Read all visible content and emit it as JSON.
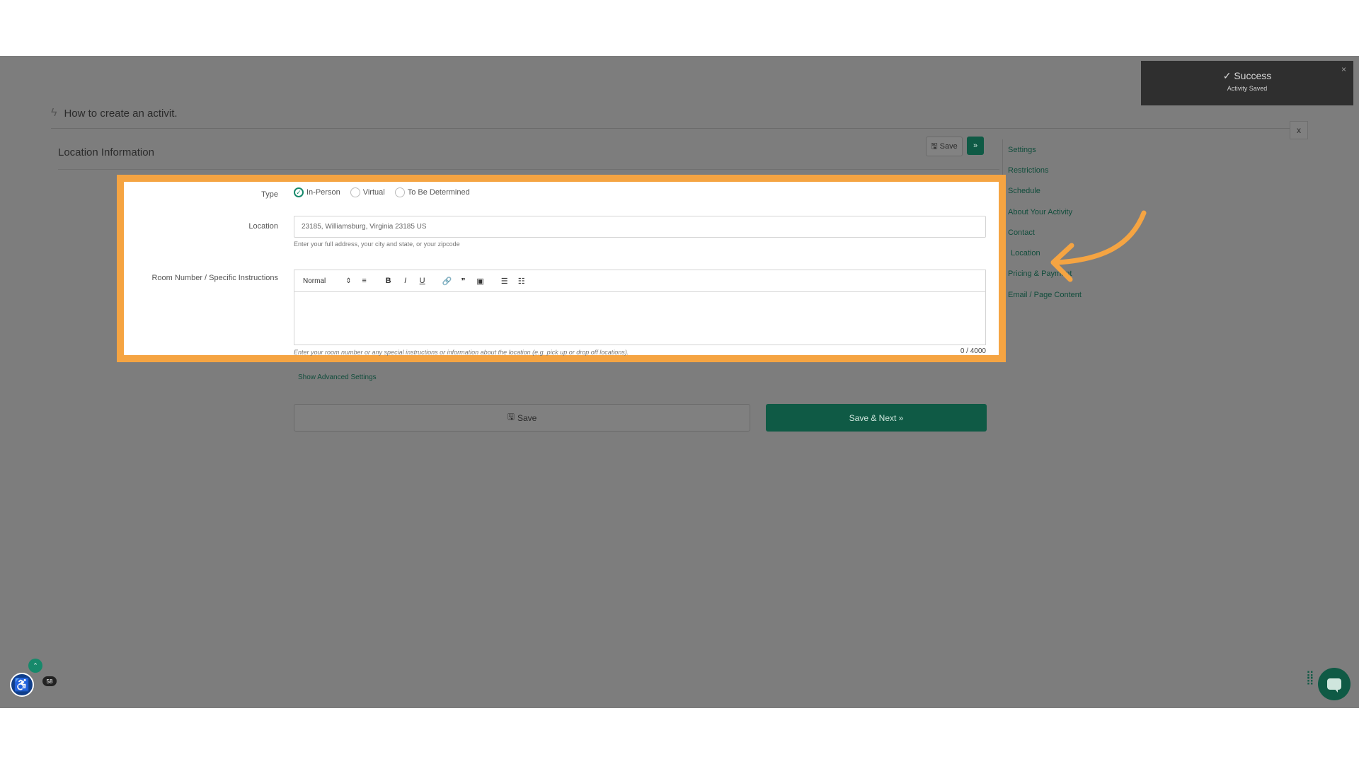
{
  "page": {
    "title": "How to create an activit.",
    "close_label": "x"
  },
  "section": {
    "title": "Location Information",
    "save_label": "Save",
    "next_label": "»"
  },
  "nav": {
    "items": [
      {
        "label": "Settings"
      },
      {
        "label": "Restrictions"
      },
      {
        "label": "Schedule"
      },
      {
        "label": "About Your Activity"
      },
      {
        "label": "Contact"
      },
      {
        "label": "Location"
      },
      {
        "label": "Pricing & Payment"
      },
      {
        "label": "Email / Page Content"
      }
    ],
    "active": "Location"
  },
  "toast": {
    "title": "Success",
    "message": "Activity Saved",
    "close": "×"
  },
  "form": {
    "type_label": "Type",
    "type_options": [
      {
        "label": "In-Person",
        "checked": true
      },
      {
        "label": "Virtual",
        "checked": false
      },
      {
        "label": "To Be Determined",
        "checked": false
      }
    ],
    "location_label": "Location",
    "location_value": "23185, Williamsburg, Virginia 23185 US",
    "location_help": "Enter your full address, your city and state, or your zipcode",
    "room_label": "Room Number / Specific Instructions",
    "editor_style": "Normal",
    "room_help": "Enter your room number or any special instructions or information about the location (e.g. pick up or drop off locations).",
    "counter": "0 / 4000",
    "advanced_link": "Show Advanced Settings",
    "save_label": "Save",
    "save_next_label": "Save & Next »"
  },
  "widgets": {
    "notification_count": "58"
  },
  "colors": {
    "accent": "#0f5a45",
    "highlight": "#f5a442",
    "overlay": "#7d7d7d"
  }
}
